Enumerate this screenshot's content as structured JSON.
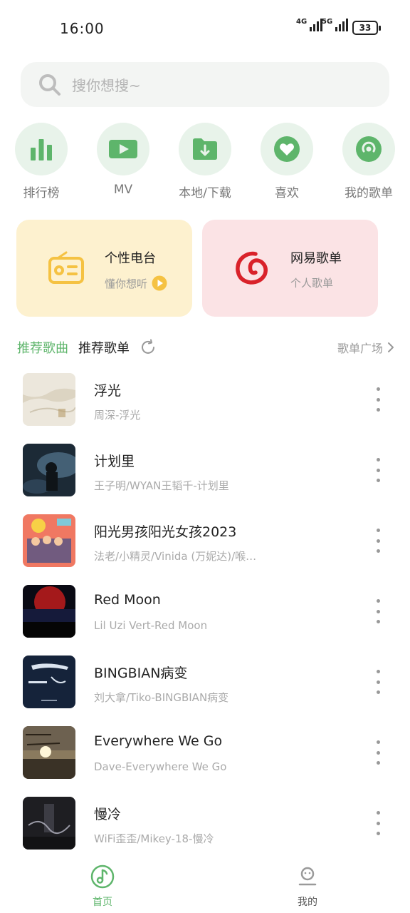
{
  "status_bar": {
    "time": "16:00",
    "net1": "4G",
    "net2": "5G",
    "battery": "33"
  },
  "search": {
    "placeholder": "搜你想搜~"
  },
  "quick_actions": [
    {
      "label": "排行榜",
      "icon": "bar-chart-icon"
    },
    {
      "label": "MV",
      "icon": "video-camera-icon"
    },
    {
      "label": "本地/下载",
      "icon": "download-folder-icon"
    },
    {
      "label": "喜欢",
      "icon": "heart-icon"
    },
    {
      "label": "我的歌单",
      "icon": "disc-icon"
    }
  ],
  "cards": {
    "radio": {
      "title": "个性电台",
      "subtitle": "懂你想听"
    },
    "netease": {
      "title": "网易歌单",
      "subtitle": "个人歌单"
    }
  },
  "tabs": {
    "recommended_songs": "推荐歌曲",
    "recommended_playlists": "推荐歌单",
    "plaza": "歌单广场"
  },
  "songs": [
    {
      "title": "浮光",
      "artist": "周深-浮光"
    },
    {
      "title": "计划里",
      "artist": "王子明/WYAN王韬千-计划里"
    },
    {
      "title": "阳光男孩阳光女孩2023",
      "artist": "法老/小精灵/Vinida (万妮达)/喉…"
    },
    {
      "title": "Red Moon",
      "artist": "Lil Uzi Vert-Red Moon"
    },
    {
      "title": "BINGBIAN病变",
      "artist": "刘大拿/Tiko-BINGBIAN病变"
    },
    {
      "title": "Everywhere We Go",
      "artist": "Dave-Everywhere We Go"
    },
    {
      "title": "慢冷",
      "artist": "WiFi歪歪/Mikey-18-慢冷"
    }
  ],
  "bottom_nav": {
    "home": "首页",
    "mine": "我的"
  },
  "colors": {
    "accent": "#5eb56b",
    "icon_bg": "#e8f3ea",
    "radio_card": "#fdf1cf",
    "netease_card": "#fbe3e5",
    "netease_red": "#d9222a",
    "radio_yellow": "#f5c242"
  }
}
